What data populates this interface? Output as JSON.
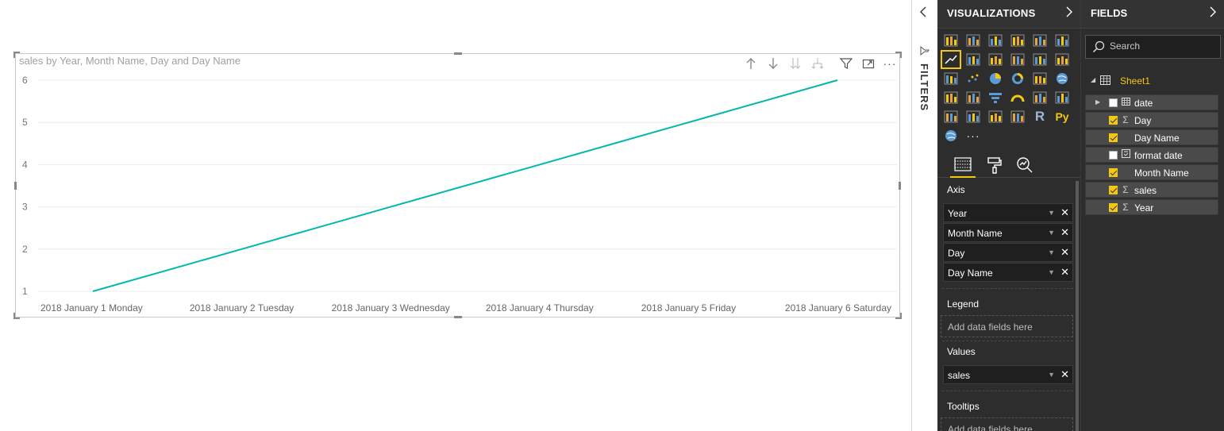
{
  "chart": {
    "title": "sales by Year, Month Name, Day and Day Name"
  },
  "chart_data": {
    "type": "line",
    "categories": [
      "2018 January 1 Monday",
      "2018 January 2 Tuesday",
      "2018 January 3 Wednesday",
      "2018 January 4 Thursday",
      "2018 January 5 Friday",
      "2018 January 6 Saturday"
    ],
    "series": [
      {
        "values": [
          1,
          2,
          3,
          4,
          5,
          6
        ],
        "color": "#01b8aa"
      }
    ],
    "ylim": [
      1,
      6
    ],
    "yticks": [
      1,
      2,
      3,
      4,
      5,
      6
    ],
    "grid": true,
    "xlabel": "",
    "ylabel": ""
  },
  "filters": {
    "label": "FILTERS"
  },
  "visualizations": {
    "title": "VISUALIZATIONS",
    "axis_label": "Axis",
    "axis_fields": [
      "Year",
      "Month Name",
      "Day",
      "Day Name"
    ],
    "legend_label": "Legend",
    "legend_placeholder": "Add data fields here",
    "values_label": "Values",
    "values_fields": [
      "sales"
    ],
    "tooltips_label": "Tooltips",
    "tooltips_placeholder": "Add data fields here",
    "more_label": "···",
    "r_label": "R",
    "py_label": "Py"
  },
  "fields": {
    "title": "FIELDS",
    "search_placeholder": "Search",
    "table_name": "Sheet1",
    "items": [
      {
        "name": "date",
        "checked": false,
        "type": "table-icon",
        "expandable": true
      },
      {
        "name": "Day",
        "checked": true,
        "type": "sigma-icon"
      },
      {
        "name": "Day Name",
        "checked": true,
        "type": ""
      },
      {
        "name": "format date",
        "checked": false,
        "type": "calc-icon"
      },
      {
        "name": "Month Name",
        "checked": true,
        "type": ""
      },
      {
        "name": "sales",
        "checked": true,
        "type": "sigma-icon"
      },
      {
        "name": "Year",
        "checked": true,
        "type": "sigma-icon"
      }
    ]
  },
  "colors": {
    "accent": "#f2c811",
    "line": "#01b8aa",
    "pane": "#2d2d2d"
  }
}
